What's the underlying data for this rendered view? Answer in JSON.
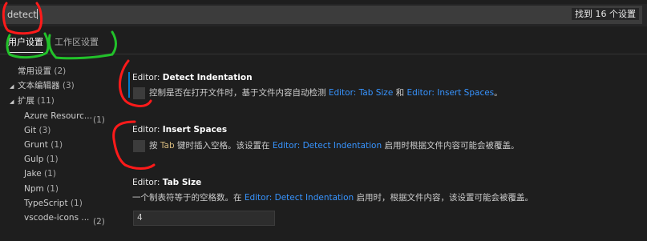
{
  "search": {
    "value": "detect",
    "result_count": "找到 16 个设置"
  },
  "tabs": [
    {
      "label": "用户设置",
      "active": true
    },
    {
      "label": "工作区设置",
      "active": false
    }
  ],
  "toc": [
    {
      "label": "常用设置",
      "count": "(2)"
    },
    {
      "label": "文本编辑器",
      "count": "(3)",
      "expanded": true
    },
    {
      "label": "扩展",
      "count": "(11)",
      "expanded": true
    },
    {
      "label": "Azure Resourc...",
      "count": "(1)"
    },
    {
      "label": "Git",
      "count": "(3)"
    },
    {
      "label": "Grunt",
      "count": "(1)"
    },
    {
      "label": "Gulp",
      "count": "(1)"
    },
    {
      "label": "Jake",
      "count": "(1)"
    },
    {
      "label": "Npm",
      "count": "(1)"
    },
    {
      "label": "TypeScript",
      "count": "(1)"
    },
    {
      "label": "vscode-icons ...",
      "count": "(2)"
    }
  ],
  "settings": {
    "detect_indentation": {
      "category": "Editor: ",
      "name": "Detect Indentation",
      "desc_before": "控制是否在打开文件时，基于文件内容自动检测 ",
      "link1": "Editor: Tab Size",
      "desc_mid": " 和 ",
      "link2": "Editor: Insert Spaces",
      "desc_after": "。",
      "checked": false
    },
    "insert_spaces": {
      "category": "Editor: ",
      "name": "Insert Spaces",
      "desc_before": "按 ",
      "code": "Tab",
      "desc_mid": " 键时插入空格。该设置在 ",
      "link": "Editor: Detect Indentation",
      "desc_after": " 启用时根据文件内容可能会被覆盖。",
      "checked": false
    },
    "tab_size": {
      "category": "Editor: ",
      "name": "Tab Size",
      "desc_before": "一个制表符等于的空格数。在 ",
      "link": "Editor: Detect Indentation",
      "desc_after": " 启用时，根据文件内容，该设置可能会被覆盖。",
      "value": "4"
    }
  },
  "annotation_colors": {
    "red": "#ff1a1a",
    "green": "#22c22a"
  }
}
